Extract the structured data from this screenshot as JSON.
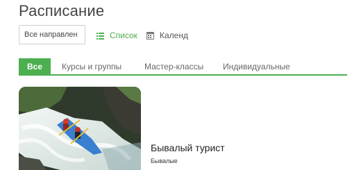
{
  "page": {
    "title": "Расписание"
  },
  "filter": {
    "value": "Все направлен"
  },
  "view": {
    "list_label": "Список",
    "calendar_label": "Календ"
  },
  "tabs": [
    {
      "label": "Все",
      "active": true
    },
    {
      "label": "Курсы и группы",
      "active": false
    },
    {
      "label": "Мастер-классы",
      "active": false
    },
    {
      "label": "Индивидуальные",
      "active": false
    }
  ],
  "event": {
    "title": "Бывалый турист",
    "subtitle": "Бывалые"
  },
  "colors": {
    "accent": "#4caf50",
    "text": "#444444"
  }
}
